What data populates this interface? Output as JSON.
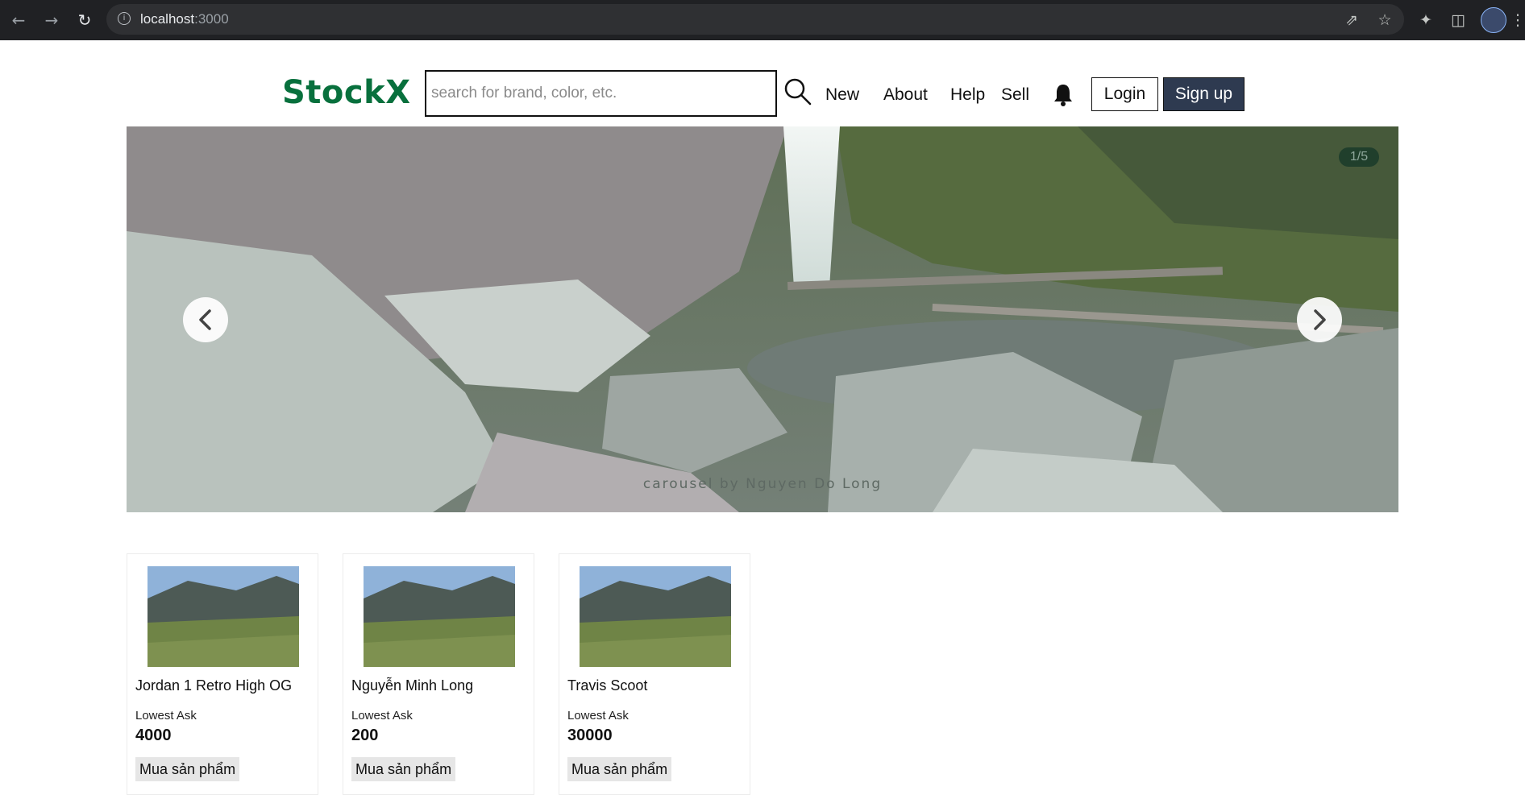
{
  "browser": {
    "url_host": "localhost",
    "url_port": ":3000"
  },
  "header": {
    "logo_main": "Stock",
    "logo_x": "X",
    "search_placeholder": "search for brand, color, etc.",
    "nav": {
      "new": "New",
      "about": "About",
      "help": "Help",
      "sell": "Sell"
    },
    "login": "Login",
    "signup": "Sign up"
  },
  "carousel": {
    "counter": "1/5",
    "caption": "carousel by Nguyen Do Long"
  },
  "products": [
    {
      "name": "Jordan 1 Retro High OG",
      "ask_label": "Lowest Ask",
      "price": "4000",
      "buy_label": "Mua sản phẩm"
    },
    {
      "name": "Nguyễn Minh Long",
      "ask_label": "Lowest Ask",
      "price": "200",
      "buy_label": "Mua sản phẩm"
    },
    {
      "name": "Travis Scoot",
      "ask_label": "Lowest Ask",
      "price": "30000",
      "buy_label": "Mua sản phẩm"
    }
  ],
  "colors": {
    "brand": "#08703d",
    "signup_bg": "#2e3a50",
    "chrome_bg": "#202124"
  }
}
